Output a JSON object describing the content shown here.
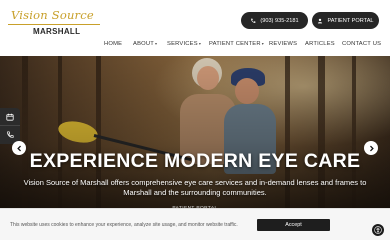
{
  "brand": {
    "script": "Vision Source",
    "location": "MARSHALL"
  },
  "header_buttons": {
    "phone": "(903) 935-2181",
    "portal": "PATIENT PORTAL"
  },
  "nav": [
    {
      "label": "HOME",
      "dropdown": false
    },
    {
      "label": "ABOUT",
      "dropdown": true
    },
    {
      "label": "SERVICES",
      "dropdown": true
    },
    {
      "label": "PATIENT CENTER",
      "dropdown": true
    },
    {
      "label": "REVIEWS",
      "dropdown": false
    },
    {
      "label": "ARTICLES",
      "dropdown": false
    },
    {
      "label": "CONTACT US",
      "dropdown": false
    }
  ],
  "hero": {
    "title": "EXPERIENCE MODERN EYE CARE",
    "subtitle": "Vision Source of Marshall offers comprehensive eye care services and in-demand lenses and frames to Marshall and the surrounding communities.",
    "button": "PATIENT PORTAL"
  },
  "cookie": {
    "text": "This website uses cookies to enhance your experience, analyze site usage, and monitor website traffic.",
    "accept": "Accept"
  },
  "icons": {
    "side_tab_1": "calendar-icon",
    "side_tab_2": "phone-icon",
    "arrow_left": "chevron-left-icon",
    "arrow_right": "chevron-right-icon",
    "accessibility": "accessibility-icon"
  },
  "colors": {
    "brand_gold": "#c8a02a",
    "dark": "#262626",
    "cookie_bg": "#f6f6f6"
  }
}
